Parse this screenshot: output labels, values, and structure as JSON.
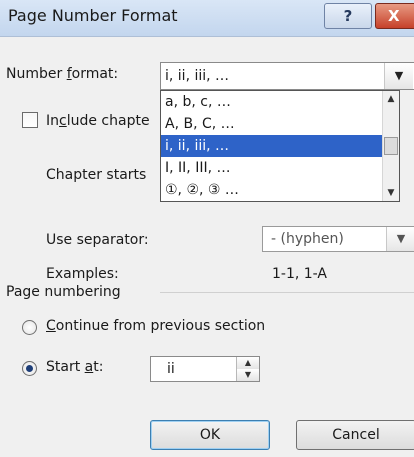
{
  "dialog": {
    "title": "Page Number Format",
    "title_buttons": {
      "help": "?",
      "close": "X"
    }
  },
  "number_format": {
    "label_pre": "Number ",
    "label_accel": "f",
    "label_post": "ormat:",
    "value": "i, ii, iii, …",
    "options": [
      "a, b, c, …",
      "A, B, C, …",
      "i, ii, iii, …",
      "I, II, III, …",
      "①, ②, ③ …"
    ],
    "selected_index": 2
  },
  "include_chapter": {
    "label_pre": "In",
    "label_accel": "c",
    "label_post": "lude chapte",
    "checked": false
  },
  "chapter_starts": {
    "label": "Chapter starts"
  },
  "separator": {
    "label": "Use separator:",
    "value": "-  (hyphen)"
  },
  "examples": {
    "label": "Examples:",
    "value": "1-1, 1-A"
  },
  "page_numbering": {
    "heading": "Page numbering",
    "continue": {
      "label_accel": "C",
      "label_post": "ontinue from previous section",
      "selected": false
    },
    "start_at": {
      "label_pre": "Start ",
      "label_accel": "a",
      "label_post": "t:",
      "selected": true,
      "value": "ii"
    }
  },
  "buttons": {
    "ok": "OK",
    "cancel": "Cancel"
  },
  "colors": {
    "selection": "#2e63c8",
    "dialog_bg": "#f0f0f0",
    "titlebar": "#c3d6ee",
    "close": "#c6412a"
  }
}
